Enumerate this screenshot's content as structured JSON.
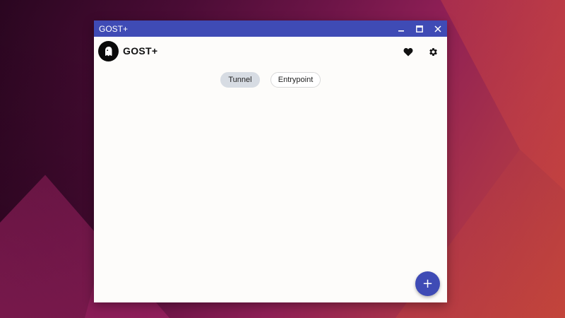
{
  "window": {
    "title": "GOST+",
    "controls": {
      "minimize": "minimize-icon",
      "maximize": "maximize-icon",
      "close": "close-icon"
    }
  },
  "header": {
    "app_name": "GOST+",
    "logo_icon": "ghost-icon",
    "actions": [
      {
        "name": "favorites",
        "icon": "heart-icon"
      },
      {
        "name": "settings",
        "icon": "gear-icon"
      }
    ]
  },
  "tabs": [
    {
      "label": "Tunnel",
      "selected": true
    },
    {
      "label": "Entrypoint",
      "selected": false
    }
  ],
  "fab": {
    "label": "+",
    "icon": "add-icon"
  },
  "colors": {
    "titlebar": "#3f4bb5",
    "accent": "#3f4bb5",
    "selected_tab": "#d7dce3",
    "window_bg": "#fdfcfa"
  }
}
